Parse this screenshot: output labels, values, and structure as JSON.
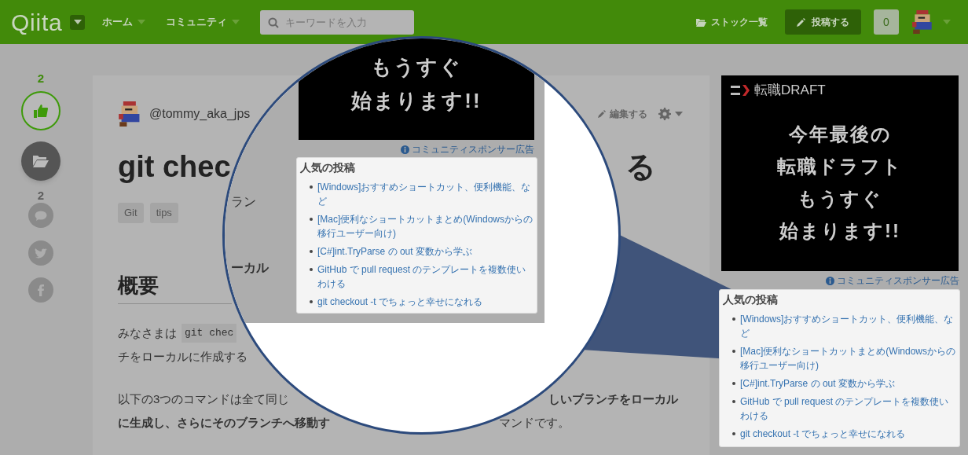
{
  "header": {
    "logo": "Qiita",
    "nav": [
      {
        "label": "ホーム"
      },
      {
        "label": "コミュニティ"
      }
    ],
    "search": {
      "placeholder": "キーワードを入力"
    },
    "stock_link": "ストック一覧",
    "post_button": "投稿する",
    "notification_count": "0"
  },
  "actions": {
    "like_count": "2",
    "liked": true,
    "comment_count": "2"
  },
  "article": {
    "author": "@tommy_aka_jps",
    "edit_link": "編集する",
    "title_left": "git chec",
    "title_right": "る",
    "tags": [
      "Git",
      "tips"
    ],
    "heading": "概要",
    "paragraph_1": {
      "lead": "みなさまは",
      "code": "git chec",
      "line_2": "チをローカルに作成する"
    },
    "paragraph_2": {
      "line_1_left": "以下の3つのコマンドは全て同じ",
      "line_1_right": "しいブランチをローカル",
      "line_2_left": "に生成し、さらにそのブランチへ移動す",
      "line_2_right": "マンドです。"
    }
  },
  "sidebar": {
    "ad": {
      "brand": "転職DRAFT",
      "lines": [
        "今年最後の",
        "転職ドラフト",
        "もうすぐ",
        "始まります!!"
      ]
    },
    "sponsor_label": "コミュニティスポンサー広告",
    "popular": {
      "title": "人気の投稿",
      "items": [
        "[Windows]おすすめショートカット、便利機能、など",
        "[Mac]便利なショートカットまとめ(Windowsからの移行ユーザー向け)",
        "[C#]int.TryParse の out 変数から学ぶ",
        "GitHub で pull request のテンプレートを複数使いわける",
        "git checkout -t でちょっと幸せになれる"
      ]
    }
  },
  "magnifier": {
    "fragments": [
      {
        "text": "ラン",
        "bold": false
      },
      {
        "text": "ーカル",
        "bold": true
      }
    ],
    "ad_lines": [
      "もうすぐ",
      "始まります!!"
    ],
    "sponsor_label": "コミュニティスポンサー広告",
    "popular": {
      "title": "人気の投稿",
      "items": [
        "[Windows]おすすめショートカット、便利機能、など",
        "[Mac]便利なショートカットまとめ(Windowsからの移行ユーザー向け)",
        "[C#]int.TryParse の out 変数から学ぶ",
        "GitHub で pull request のテンプレートを複数使いわける",
        "git checkout -t でちょっと幸せになれる"
      ]
    }
  }
}
